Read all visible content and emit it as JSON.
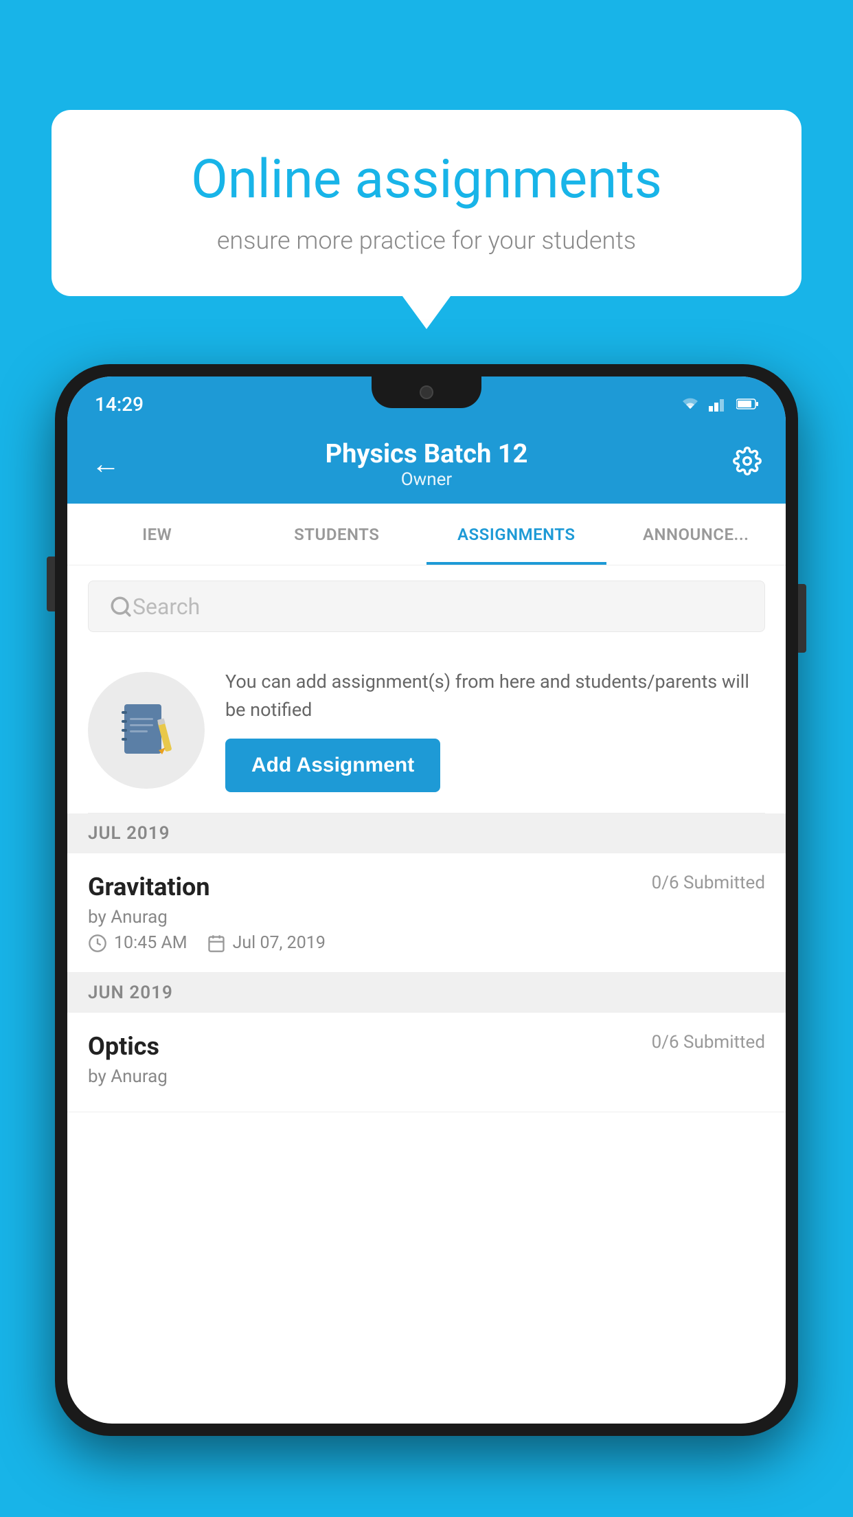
{
  "background_color": "#18b4e8",
  "bubble": {
    "title": "Online assignments",
    "subtitle": "ensure more practice for your students"
  },
  "status_bar": {
    "time": "14:29",
    "wifi": "▲",
    "signal": "▲",
    "battery": "▮"
  },
  "header": {
    "title": "Physics Batch 12",
    "subtitle": "Owner",
    "back_label": "←",
    "gear_label": "⚙"
  },
  "tabs": [
    {
      "label": "IEW",
      "active": false
    },
    {
      "label": "STUDENTS",
      "active": false
    },
    {
      "label": "ASSIGNMENTS",
      "active": true
    },
    {
      "label": "ANNOUNCE...",
      "active": false
    }
  ],
  "search": {
    "placeholder": "Search"
  },
  "promo": {
    "text": "You can add assignment(s) from here and students/parents will be notified",
    "button_label": "Add Assignment"
  },
  "sections": [
    {
      "label": "JUL 2019",
      "assignments": [
        {
          "title": "Gravitation",
          "submitted": "0/6 Submitted",
          "by": "by Anurag",
          "time": "10:45 AM",
          "date": "Jul 07, 2019"
        }
      ]
    },
    {
      "label": "JUN 2019",
      "assignments": [
        {
          "title": "Optics",
          "submitted": "0/6 Submitted",
          "by": "by Anurag",
          "time": "",
          "date": ""
        }
      ]
    }
  ]
}
